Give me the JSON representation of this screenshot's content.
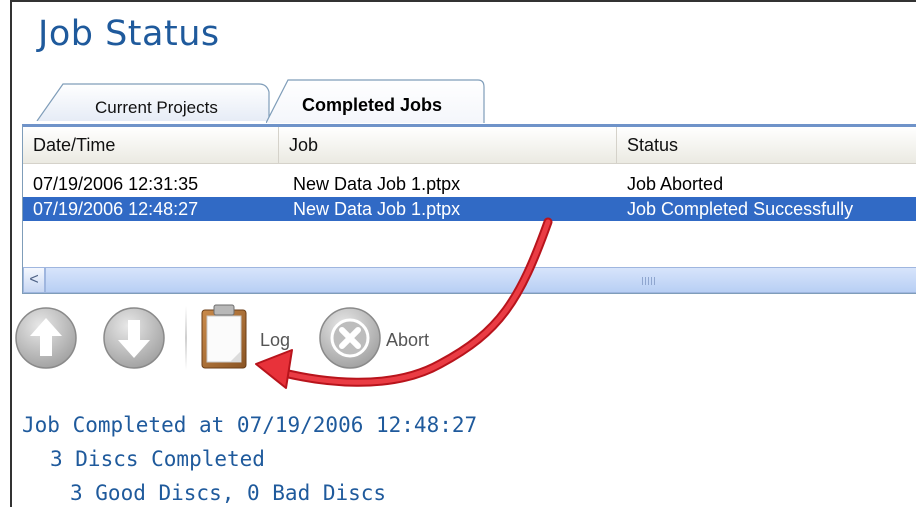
{
  "window": {
    "title": "Job Status"
  },
  "tabs": [
    {
      "label": "Current Projects",
      "active": false
    },
    {
      "label": "Completed Jobs",
      "active": true
    }
  ],
  "list": {
    "columns": [
      "Date/Time",
      "Job",
      "Status"
    ],
    "rows": [
      {
        "datetime": "07/19/2006 12:31:35",
        "job": "New Data Job 1.ptpx",
        "status": "Job Aborted",
        "selected": false
      },
      {
        "datetime": "07/19/2006 12:48:27",
        "job": "New Data Job 1.ptpx",
        "status": "Job Completed Successfully",
        "selected": true
      }
    ],
    "scroll_left_glyph": "<"
  },
  "toolbar": {
    "up_icon": "arrow-up-circle-icon",
    "down_icon": "arrow-down-circle-icon",
    "log_icon": "clipboard-icon",
    "log_label": "Log",
    "abort_icon": "x-circle-icon",
    "abort_label": "Abort"
  },
  "status": {
    "line1": "Job Completed at 07/19/2006 12:48:27",
    "line2": "3 Discs Completed",
    "line3": "3 Good Discs, 0 Bad Discs"
  },
  "colors": {
    "title": "#1f5a9c",
    "selection": "#316ac5",
    "annotation_arrow": "#e8323a"
  }
}
